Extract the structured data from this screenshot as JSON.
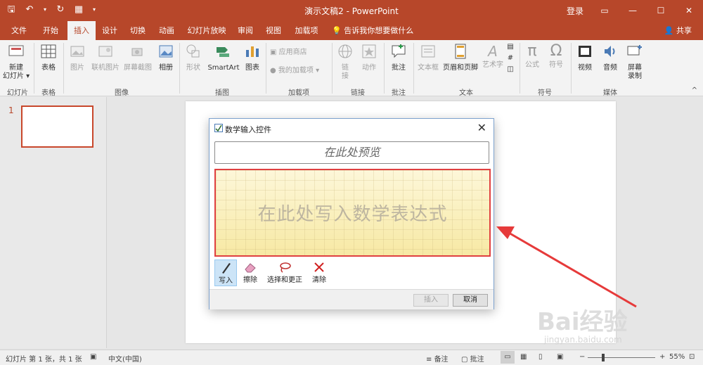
{
  "app": {
    "title": "演示文稿2  -  PowerPoint",
    "signin": "登录",
    "qat": [
      {
        "name": "save-icon",
        "glyph": "💾"
      },
      {
        "name": "undo-icon",
        "glyph": "↶"
      },
      {
        "name": "redo-icon",
        "glyph": "↻"
      },
      {
        "name": "present-icon",
        "glyph": "▦"
      }
    ],
    "window_controls": [
      {
        "name": "ribbon-display-icon",
        "glyph": "▭"
      },
      {
        "name": "minimize-icon",
        "glyph": "—"
      },
      {
        "name": "maximize-icon",
        "glyph": "☐"
      },
      {
        "name": "close-icon",
        "glyph": "✕"
      }
    ]
  },
  "tabs": [
    "文件",
    "开始",
    "插入",
    "设计",
    "切换",
    "动画",
    "幻灯片放映",
    "审阅",
    "视图",
    "加载项"
  ],
  "active_tab": "插入",
  "tell_me": "告诉我你想要做什么",
  "share": "共享",
  "ribbon": {
    "new_slide": "新建\n幻灯片 ▾",
    "table": "表格",
    "picture": "图片",
    "online_picture": "联机图片",
    "screenshot": "屏幕截图",
    "album": "相册",
    "shapes": "形状",
    "smartart": "SmartArt",
    "chart": "图表",
    "store": "应用商店",
    "my_addins": "我的加载项",
    "link": "链\n接",
    "action": "动作",
    "comment": "批注",
    "textbox": "文本框",
    "header_footer": "页眉和页脚",
    "wordart": "艺术字",
    "equation": "公式",
    "symbol": "符号",
    "video": "视频",
    "audio": "音频",
    "screen_record": "屏幕\n录制",
    "groups": {
      "slides": "幻灯片",
      "tables": "表格",
      "images": "图像",
      "illustrations": "插图",
      "addins": "加载项",
      "links": "链接",
      "comments": "批注",
      "text": "文本",
      "symbols": "符号",
      "media": "媒体"
    }
  },
  "thumbs": {
    "slide_number": "1"
  },
  "dialog": {
    "title": "数学输入控件",
    "preview_placeholder": "在此处预览",
    "write_placeholder": "在此处写入数学表达式",
    "tools": [
      {
        "label": "写入",
        "icon": "pen-icon",
        "active": true
      },
      {
        "label": "擦除",
        "icon": "eraser-icon",
        "active": false
      },
      {
        "label": "选择和更正",
        "icon": "lasso-icon",
        "active": false
      },
      {
        "label": "清除",
        "icon": "clear-icon",
        "active": false
      }
    ],
    "insert": "插入",
    "cancel": "取消"
  },
  "status": {
    "slide_info": "幻灯片 第 1 张，共 1 张",
    "language": "中文(中国)",
    "notes": "备注",
    "comments": "批注",
    "zoom": "55%",
    "zoom_out": "−",
    "zoom_in": "+"
  },
  "watermark": {
    "brand": "Bai经验",
    "site": "jingyan.baidu.com"
  },
  "colors": {
    "accent": "#b7472a",
    "annotation": "#e63a3a"
  }
}
